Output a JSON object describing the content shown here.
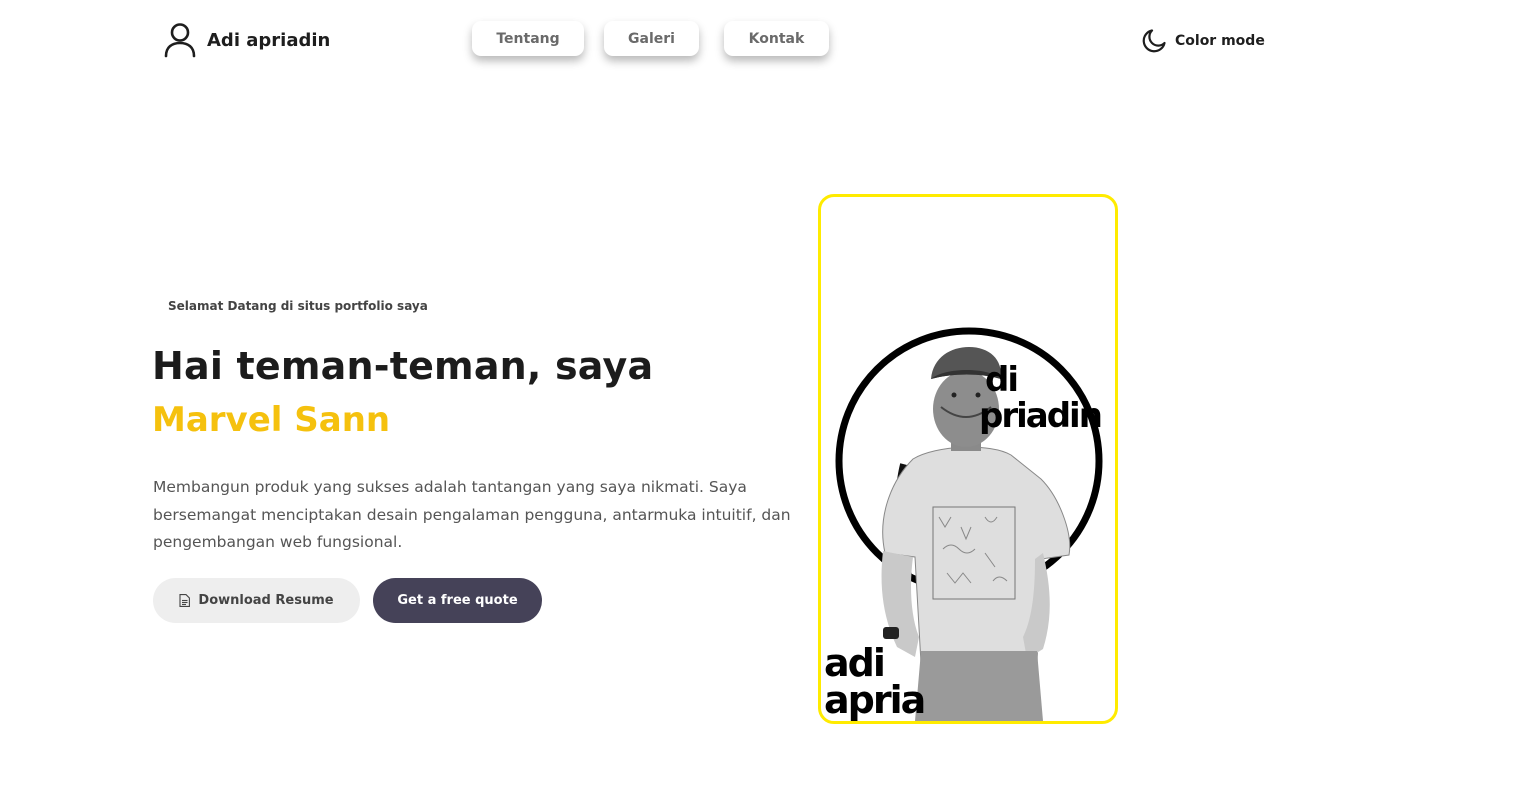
{
  "header": {
    "brand_name": "Adi apriadin",
    "brand_icon": "user-icon",
    "nav": [
      {
        "label": "Tentang"
      },
      {
        "label": "Galeri"
      },
      {
        "label": "Kontak"
      }
    ],
    "color_mode_label": "Color mode",
    "color_mode_icon": "moon-icon"
  },
  "hero": {
    "welcome": "Selamat Datang di situs portfolio saya",
    "headline": "Hai teman-teman, saya",
    "name": "Marvel Sann",
    "description": "Membangun produk yang sukses adalah tantangan yang saya nikmati. Saya bersemangat menciptakan desain pengalaman pengguna, antarmuka intuitif, dan pengembangan web fungsional.",
    "download_label": "Download Resume",
    "download_icon": "document-icon",
    "quote_label": "Get a free quote"
  },
  "photo": {
    "text_top_line1": "di",
    "text_top_line2": "priadin",
    "text_bottom_line1": "adi",
    "text_bottom_line2": "apria"
  },
  "colors": {
    "accent_yellow": "#f5c10e",
    "card_border": "#ffeb00",
    "primary_button": "#454258",
    "secondary_button": "#eeeeee"
  }
}
